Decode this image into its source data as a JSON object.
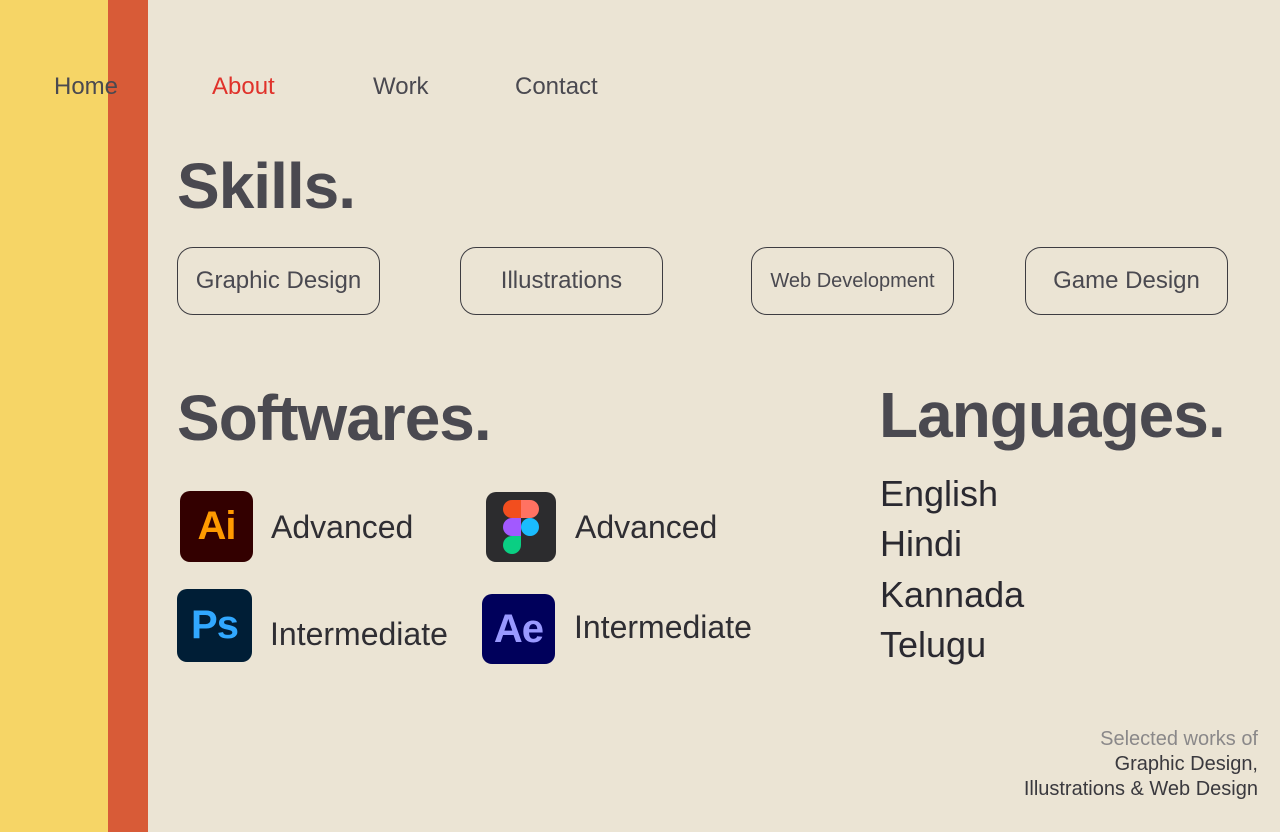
{
  "nav": {
    "items": [
      "Home",
      "About",
      "Work",
      "Contact"
    ],
    "active": "About"
  },
  "skills": {
    "title": "Skills.",
    "items": [
      "Graphic Design",
      "Illustrations",
      "Web Development",
      "Game Design"
    ]
  },
  "softwares": {
    "title": "Softwares.",
    "items": [
      {
        "icon": "adobe-illustrator-icon",
        "abbr": "Ai",
        "level": "Advanced"
      },
      {
        "icon": "figma-icon",
        "abbr": "",
        "level": "Advanced"
      },
      {
        "icon": "adobe-photoshop-icon",
        "abbr": "Ps",
        "level": "Intermediate"
      },
      {
        "icon": "adobe-after-effects-icon",
        "abbr": "Ae",
        "level": "Intermediate"
      }
    ]
  },
  "languages": {
    "title": "Languages.",
    "items": [
      "English",
      "Hindi",
      "Kannada",
      "Telugu"
    ]
  },
  "footer": {
    "line1": "Selected works of",
    "line2": "Graphic Design,",
    "line3": "Illustrations & Web Design"
  },
  "colors": {
    "background": "#ebe4d4",
    "stripe_yellow": "#f6d566",
    "stripe_orange": "#d85b37",
    "nav_active": "#e0322b",
    "text": "#4a4950"
  }
}
